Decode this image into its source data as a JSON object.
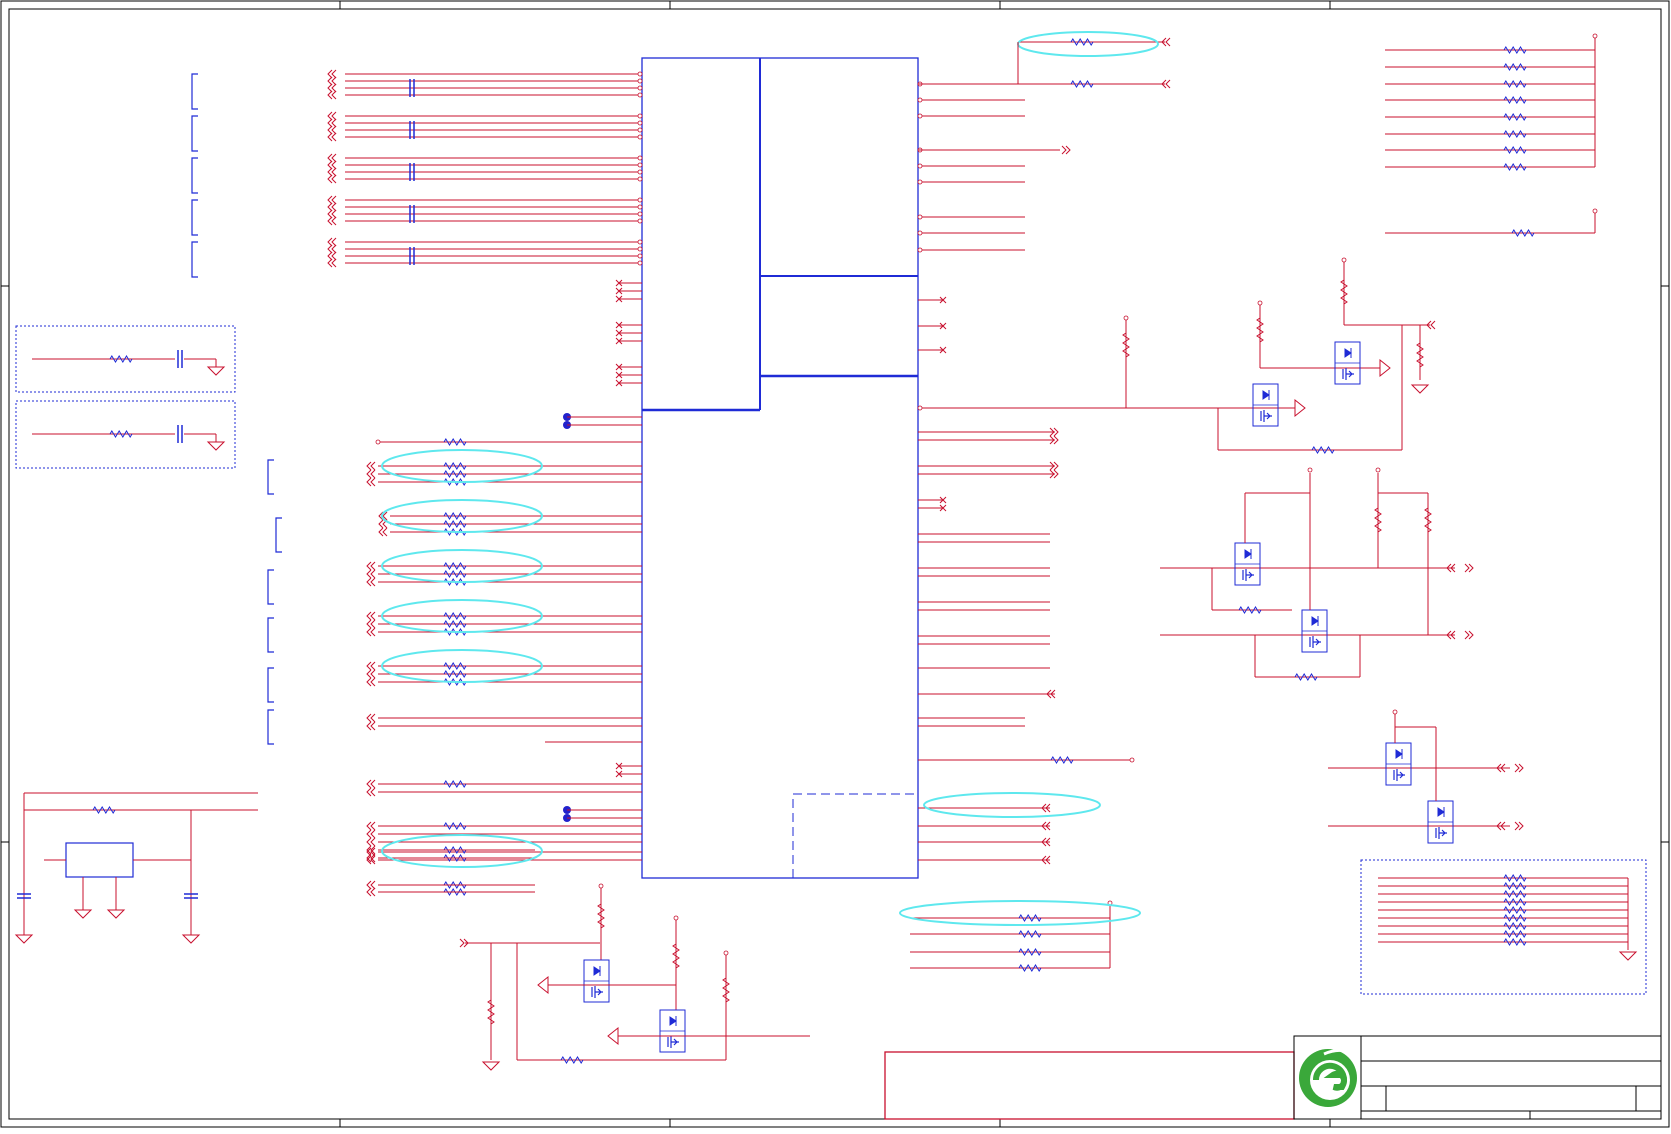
{
  "colors": {
    "frame": "#000000",
    "wire": "#c8102e",
    "component": "#1f2bd6",
    "highlight": "#5ee8ee",
    "junction": "#2222cc",
    "background": "#ffffff",
    "logo_green": "#3aa83a"
  },
  "page": {
    "title_text": "",
    "logo_icon": "green-e-logo-icon"
  },
  "groups": [
    {
      "name": "ic-main",
      "kind": "integrated-circuit"
    },
    {
      "name": "resistor-pull-up-array",
      "kind": "resistor-array"
    },
    {
      "name": "level-shifter-mosfets",
      "kind": "mosfet-pairs"
    },
    {
      "name": "crystal-oscillator",
      "kind": "crystal"
    },
    {
      "name": "termination-rc",
      "kind": "rc-network"
    }
  ]
}
